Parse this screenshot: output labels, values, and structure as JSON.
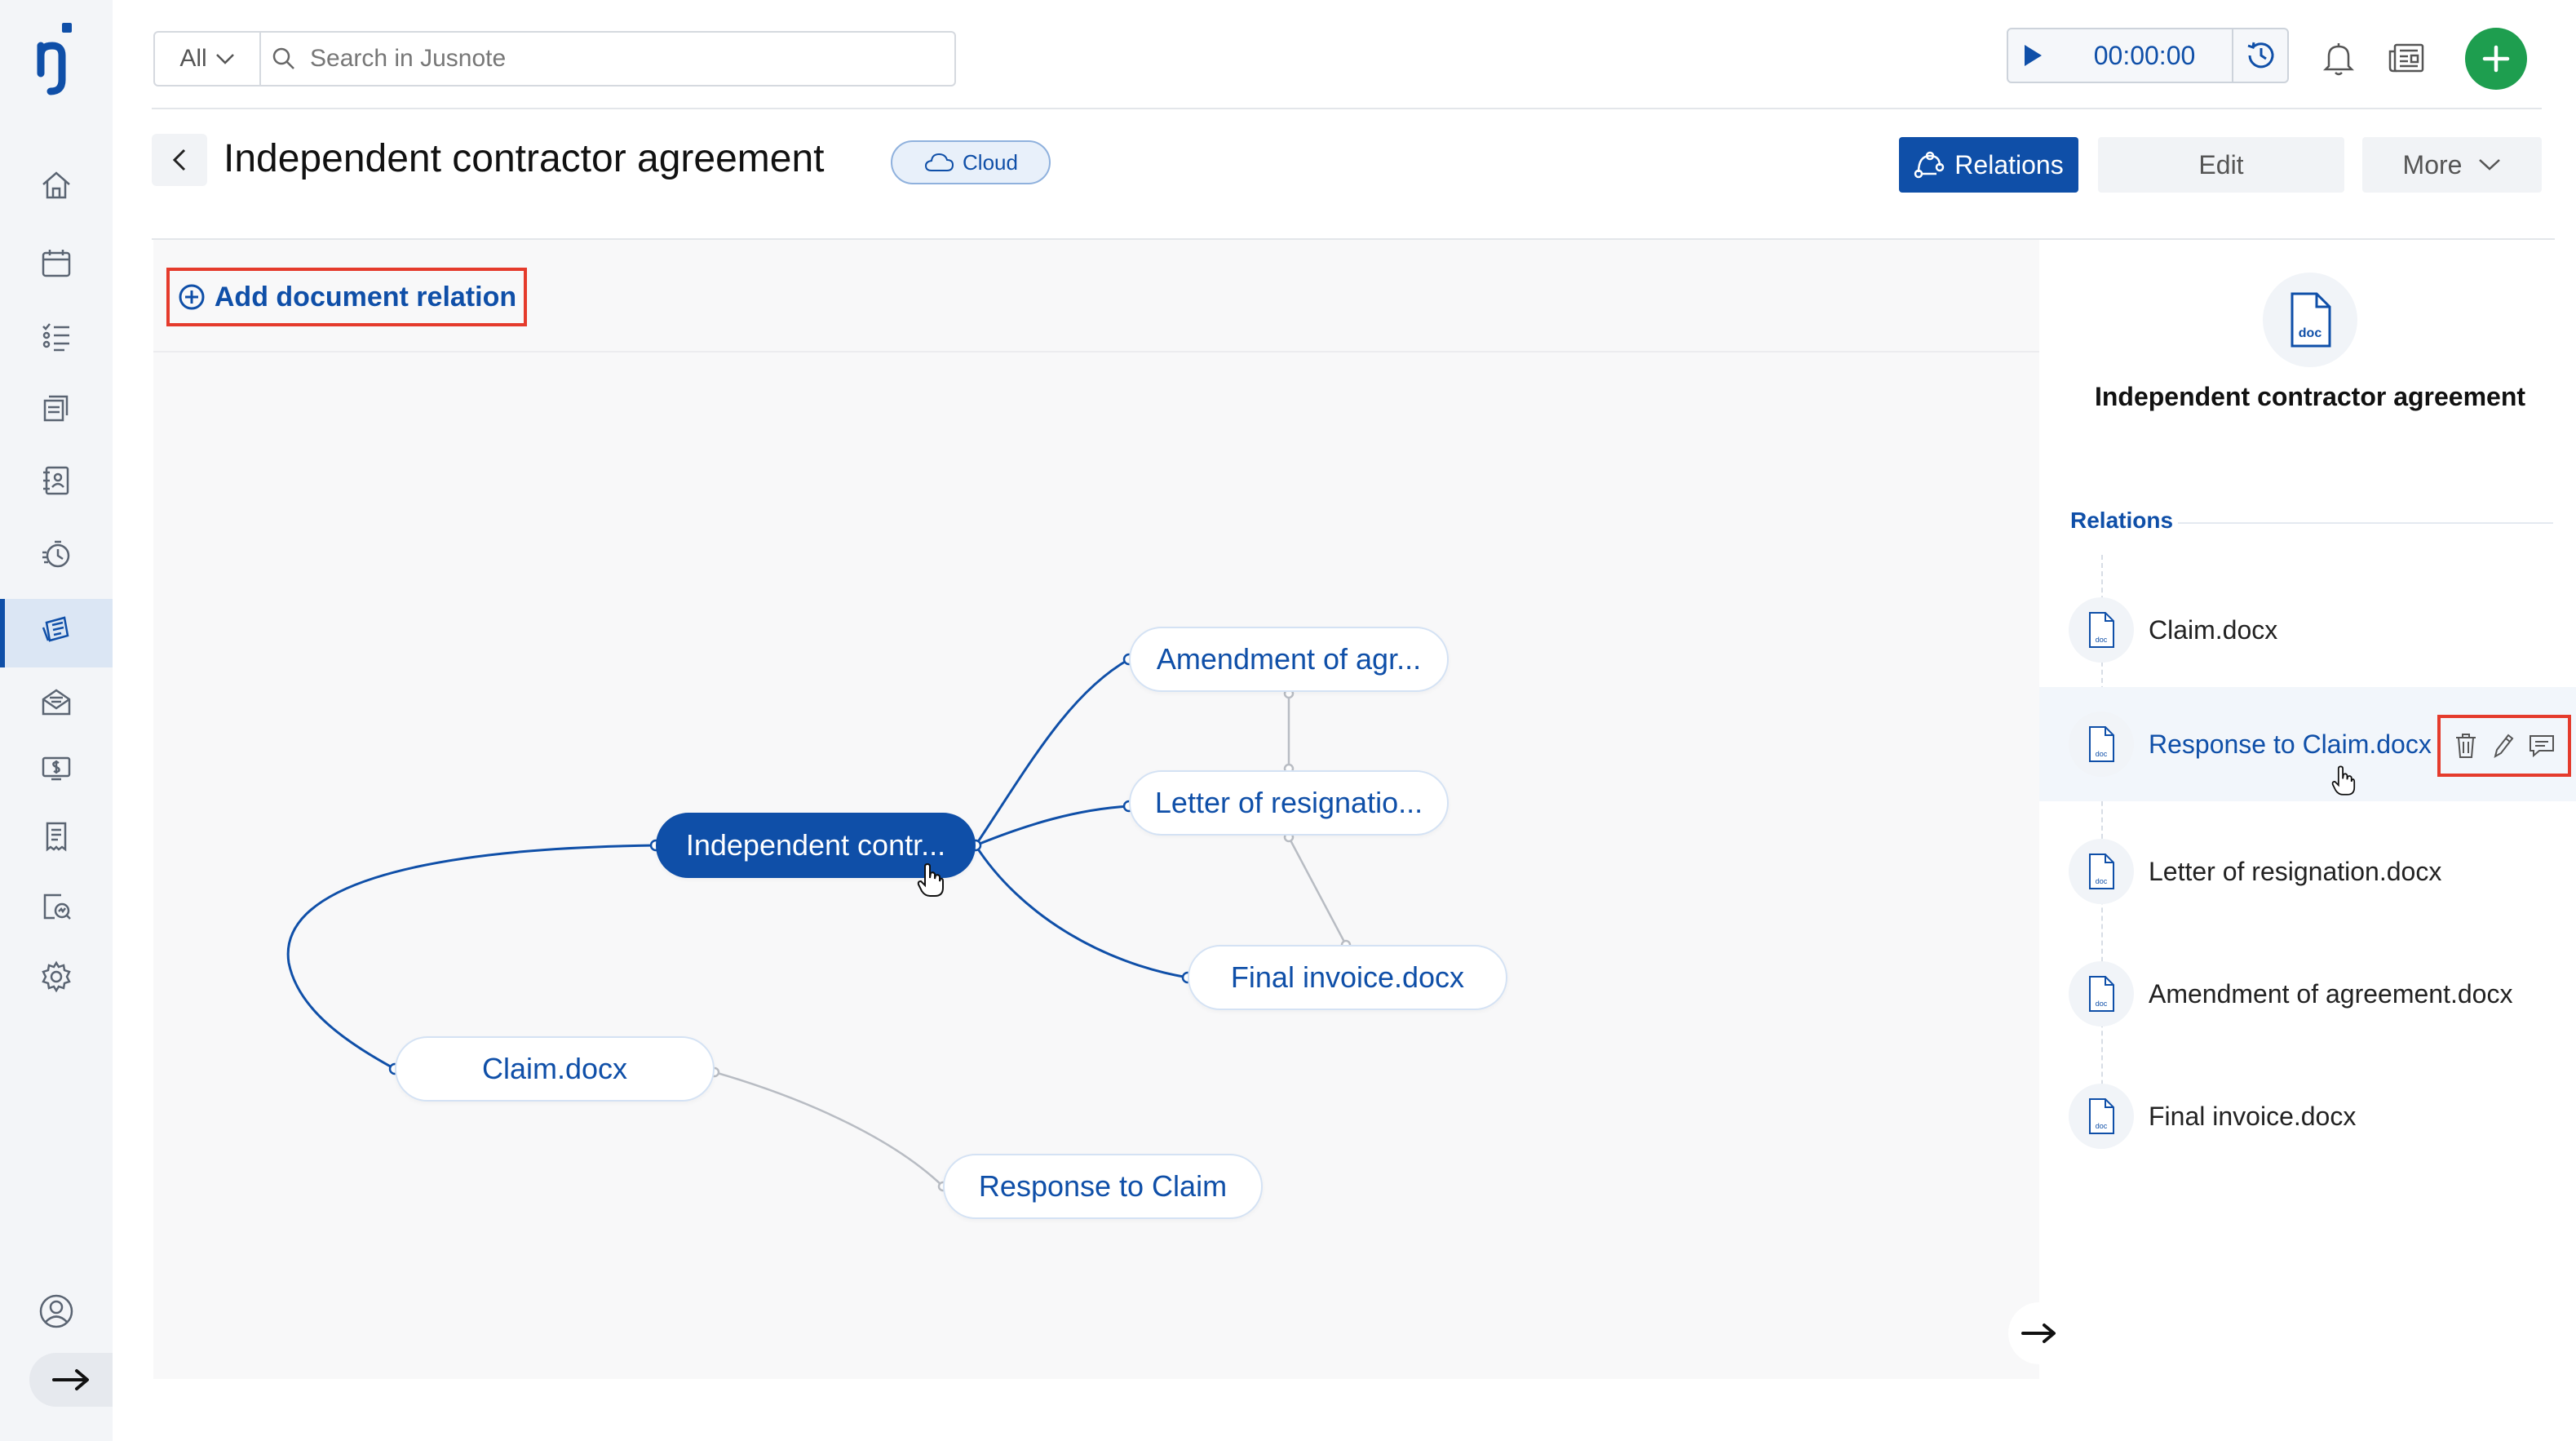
{
  "app": {
    "logo_text": "ŋ"
  },
  "search": {
    "scope": "All",
    "placeholder": "Search in Jusnote"
  },
  "timer": {
    "value": "00:00:00"
  },
  "header": {
    "title": "Independent contractor agreement",
    "badge": "Cloud",
    "relations_label": "Relations",
    "edit_label": "Edit",
    "more_label": "More"
  },
  "canvas": {
    "add_relation_label": "Add document relation",
    "nodes": {
      "main": "Independent contr...",
      "amendment": "Amendment of agr...",
      "letter": "Letter of resignatio...",
      "final": "Final invoice.docx",
      "claim": "Claim.docx",
      "response": "Response to Claim"
    }
  },
  "panel": {
    "doc_icon_label": "doc",
    "title": "Independent contractor agreement",
    "relations_heading": "Relations",
    "items": [
      {
        "name": "Claim.docx"
      },
      {
        "name": "Response to Claim.docx"
      },
      {
        "name": "Letter of resignation.docx"
      },
      {
        "name": "Amendment of agreement.docx"
      },
      {
        "name": "Final invoice.docx"
      }
    ]
  },
  "colors": {
    "brand": "#0f4fa8",
    "accent_green": "#1e9e4f",
    "highlight_red": "#e53b2c"
  }
}
